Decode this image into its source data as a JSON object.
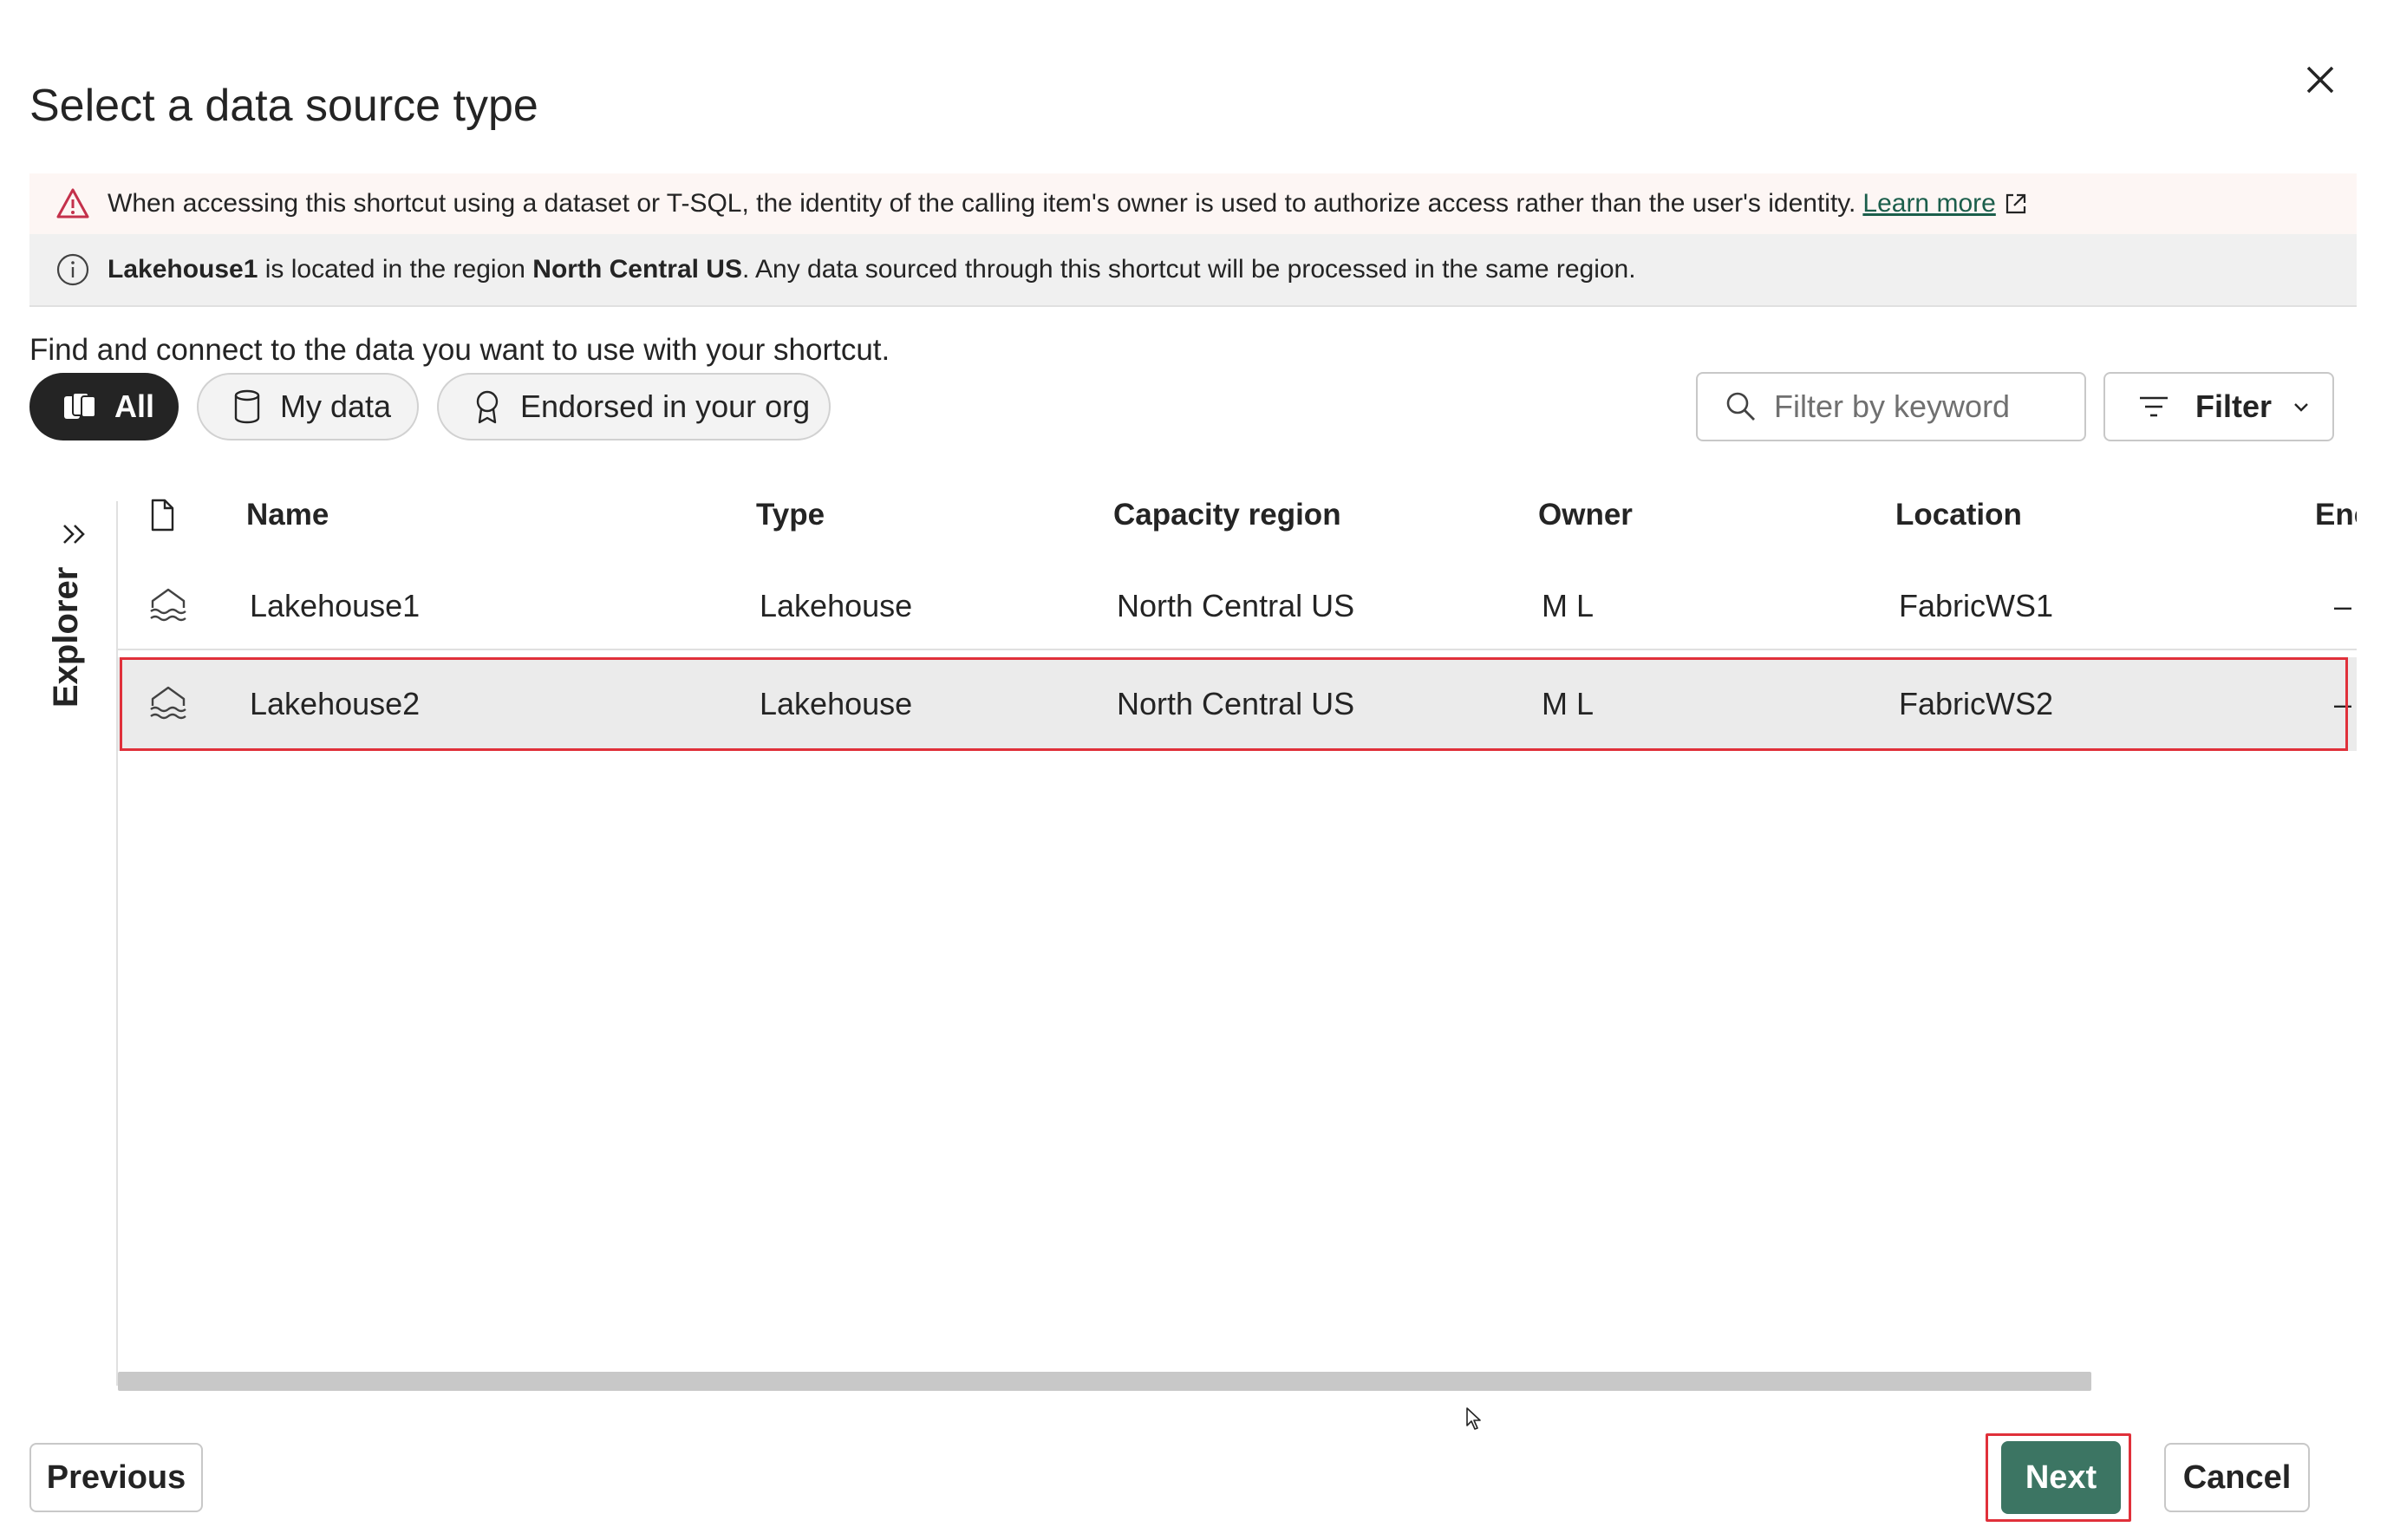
{
  "dialog": {
    "title": "Select a data source type",
    "close_label": "Close"
  },
  "warning": {
    "text": "When accessing this shortcut using a dataset or T-SQL, the identity of the calling item's owner is used to authorize access rather than the user's identity.",
    "link": "Learn more"
  },
  "info": {
    "item": "Lakehouse1",
    "text_mid": " is located in the region ",
    "region": "North Central US",
    "text_end": ". Any data sourced through this shortcut will be processed in the same region."
  },
  "subtitle": "Find and connect to the data you want to use with your shortcut.",
  "pills": [
    {
      "label": "All",
      "icon": "stack-icon",
      "active": true
    },
    {
      "label": "My data",
      "icon": "database-icon",
      "active": false
    },
    {
      "label": "Endorsed in your org",
      "icon": "badge-icon",
      "active": false
    }
  ],
  "search": {
    "placeholder": "Filter by keyword",
    "value": ""
  },
  "filter": {
    "label": "Filter"
  },
  "explorer": {
    "label": "Explorer"
  },
  "table": {
    "headers": [
      "Name",
      "Type",
      "Capacity region",
      "Owner",
      "Location",
      "Enc"
    ],
    "rows": [
      {
        "name": "Lakehouse1",
        "type": "Lakehouse",
        "region": "North Central US",
        "owner": "M L",
        "location": "FabricWS1",
        "enc": "–",
        "selected": false
      },
      {
        "name": "Lakehouse2",
        "type": "Lakehouse",
        "region": "North Central US",
        "owner": "M L",
        "location": "FabricWS2",
        "enc": "–",
        "selected": true
      }
    ]
  },
  "footer": {
    "previous": "Previous",
    "next": "Next",
    "cancel": "Cancel"
  },
  "colors": {
    "accent": "#3c7563",
    "highlight": "#e0303a",
    "selected_row": "#ebebeb",
    "warning_bg": "#fdf6f4",
    "info_bg": "#f0f0f0"
  }
}
